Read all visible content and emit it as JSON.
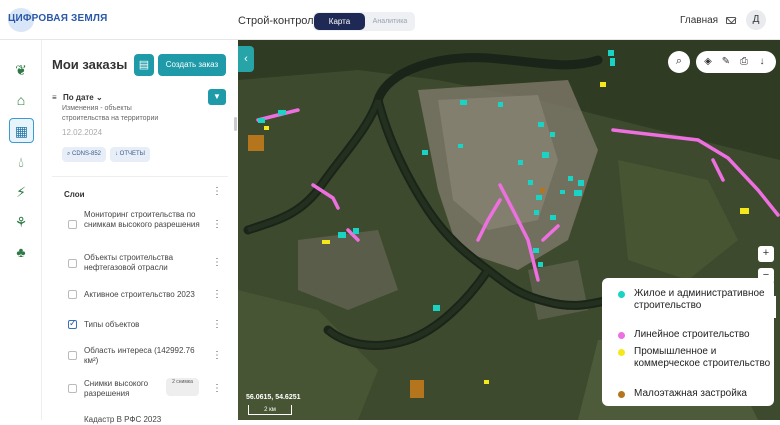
{
  "header": {
    "logo": "ЦИФРОВАЯ ЗЕМЛЯ",
    "app_title": "Строй-контроль",
    "tabs": [
      "Карта",
      "Аналитика"
    ],
    "home": "Главная",
    "avatar_initial": "Д"
  },
  "sidebar_icons": [
    "sprout-icon",
    "building-icon",
    "city-icon",
    "drop-icon",
    "lightning-icon",
    "wheat-icon",
    "trees-icon"
  ],
  "panel": {
    "title": "Мои заказы",
    "create_button": "Создать заказ",
    "sort_label": "По дате",
    "order_desc": "Изменения - объекты строительства на территории",
    "order_date": "12.02.2024",
    "chips": [
      "CDNS-852",
      "ОТЧЕТЫ"
    ],
    "layers_title": "Слои",
    "layers": [
      {
        "label": "Мониторинг строительства по снимкам высокого разрешения",
        "checked": false
      },
      {
        "label": "Объекты строительства нефтегазовой отрасли",
        "checked": false
      },
      {
        "label": "Активное строительство 2023",
        "checked": false
      },
      {
        "label": "Типы объектов",
        "checked": true
      },
      {
        "label": "Область интереса (142992.76 км²)",
        "checked": false
      },
      {
        "label": "Снимки высокого разрешения",
        "checked": false
      },
      {
        "label": "Кадастр В РФС 2023",
        "checked": false
      }
    ],
    "snapshot_count": "2 снимка"
  },
  "map": {
    "coords": "56.0615, 54.6251",
    "scale": "2 км",
    "zoom_in": "+",
    "zoom_out": "−"
  },
  "legend": [
    {
      "label": "Жилое и административное строительство",
      "color": "#19d3c5"
    },
    {
      "label": "Линейное строительство",
      "color": "#ee6fe0"
    },
    {
      "label": "Промышленное и коммерческое строительство",
      "color": "#f4e81a"
    },
    {
      "label": "Малоэтажная застройка",
      "color": "#b5751c"
    }
  ],
  "colors": {
    "accent": "#1e9aa8",
    "nav_active": "#1e2a55"
  }
}
